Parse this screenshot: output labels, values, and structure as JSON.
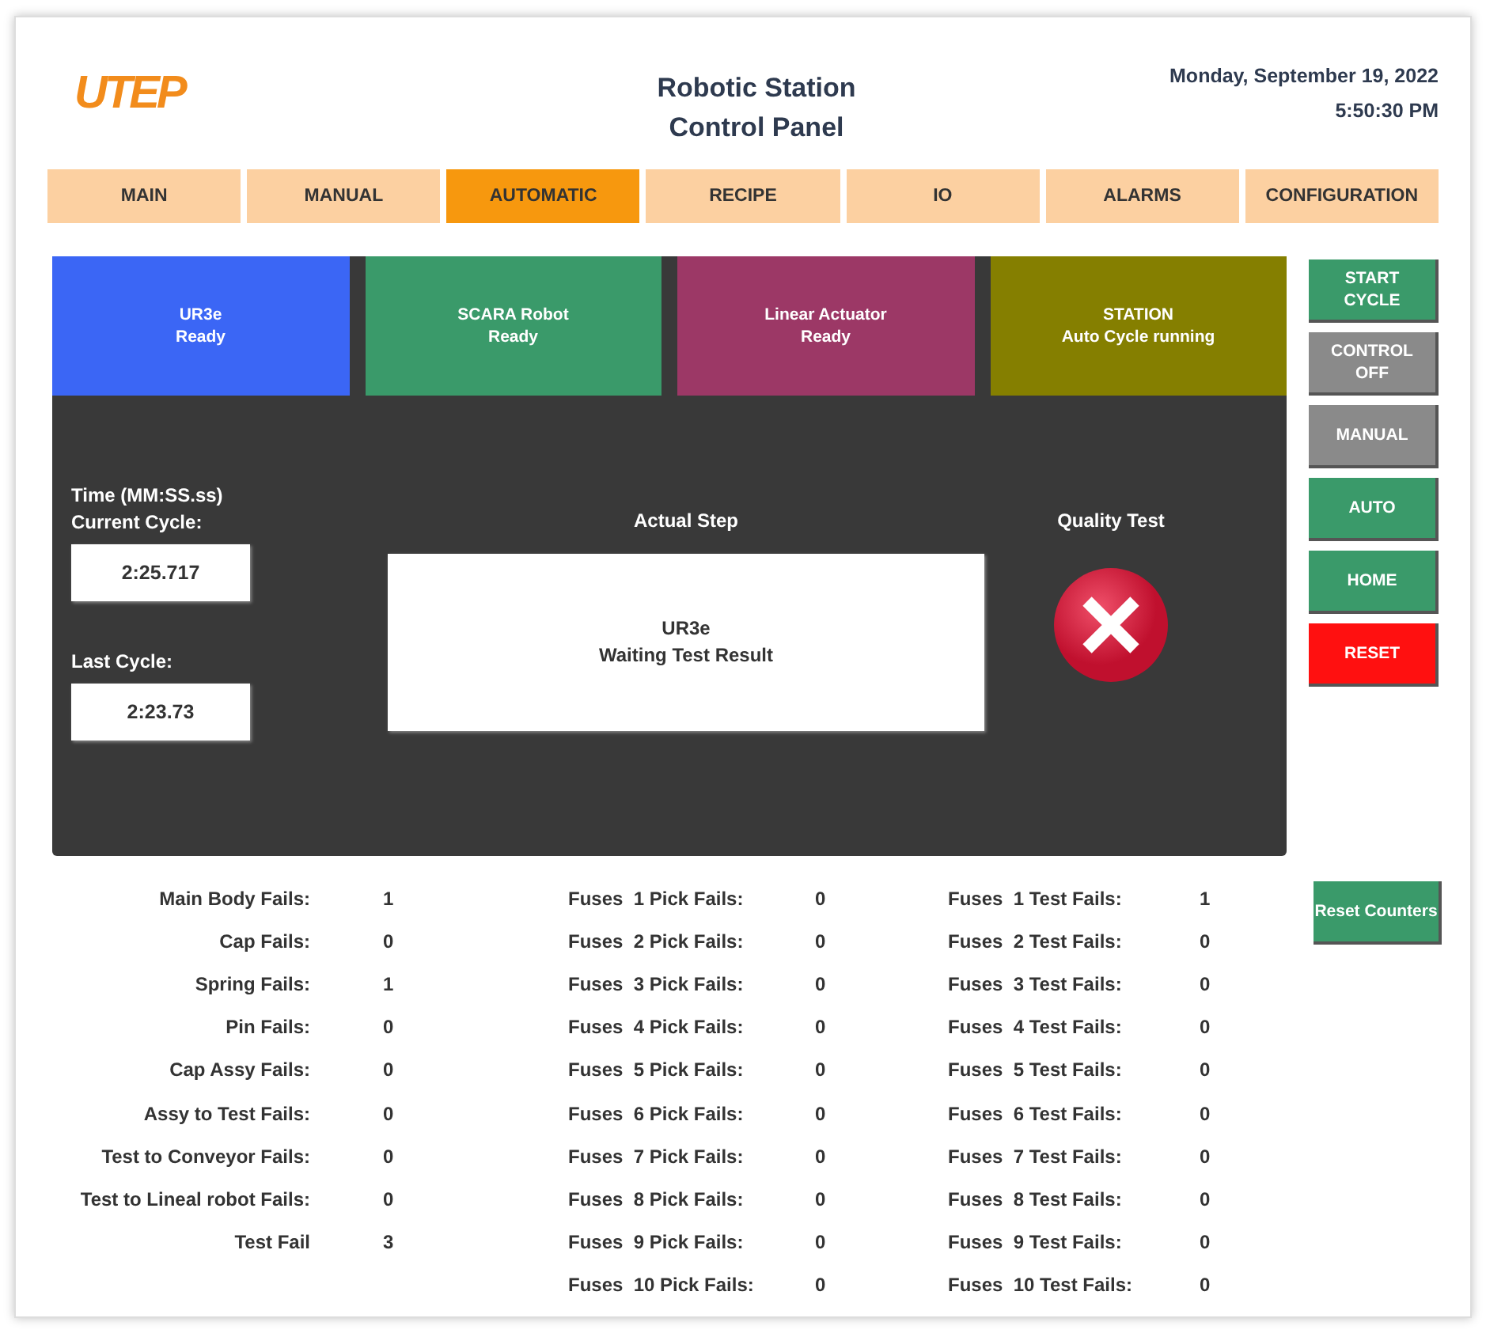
{
  "header": {
    "logo": "UTEP",
    "title_lines": [
      "Robotic Station",
      "Control Panel"
    ],
    "date": "Monday, September 19, 2022",
    "time": "5:50:30 PM"
  },
  "tabs": [
    {
      "label": "MAIN",
      "selected": false
    },
    {
      "label": "MANUAL",
      "selected": false
    },
    {
      "label": "AUTOMATIC",
      "selected": true
    },
    {
      "label": "RECIPE",
      "selected": false
    },
    {
      "label": "IO",
      "selected": false
    },
    {
      "label": "ALARMS",
      "selected": false
    },
    {
      "label": "CONFIGURATION",
      "selected": false
    }
  ],
  "status_tiles": [
    {
      "lines": [
        "UR3e",
        "Ready"
      ],
      "color": "#3b66f5"
    },
    {
      "lines": [
        "SCARA Robot",
        "Ready"
      ],
      "color": "#3a9a6a"
    },
    {
      "lines": [
        "Linear Actuator",
        "Ready"
      ],
      "color": "#9c3866"
    },
    {
      "lines": [
        "STATION",
        "Auto Cycle running"
      ],
      "color": "#857f00"
    }
  ],
  "times": {
    "heading": "Time (MM:SS.ss)",
    "current_label": "Current Cycle:",
    "current_value": "2:25.717",
    "last_label": "Last Cycle:",
    "last_value": "2:23.73"
  },
  "actual_step": {
    "label": "Actual Step",
    "lines": [
      "UR3e",
      "Waiting Test Result"
    ]
  },
  "quality_test": {
    "label": "Quality Test",
    "passed": false
  },
  "side_buttons": [
    {
      "lines": [
        "START",
        "CYCLE"
      ],
      "color": "#3a9a6a"
    },
    {
      "lines": [
        "CONTROL",
        "OFF"
      ],
      "color": "#8a8a8a"
    },
    {
      "lines": [
        "MANUAL"
      ],
      "color": "#8a8a8a"
    },
    {
      "lines": [
        "AUTO"
      ],
      "color": "#3a9a6a"
    },
    {
      "lines": [
        "HOME"
      ],
      "color": "#3a9a6a"
    },
    {
      "lines": [
        "RESET"
      ],
      "color": "#ff1010"
    }
  ],
  "counters": [
    [
      {
        "label": "Main Body Fails:",
        "value": "1"
      },
      {
        "label": "Cap Fails:",
        "value": "0"
      },
      {
        "label": "Spring Fails:",
        "value": "1"
      },
      {
        "label": "Pin Fails:",
        "value": "0"
      },
      {
        "label": "Cap Assy Fails:",
        "value": "0"
      },
      {
        "label": "Assy to Test Fails:",
        "value": "0"
      },
      {
        "label": "Test to Conveyor Fails:",
        "value": "0"
      },
      {
        "label": "Test to Lineal robot Fails:",
        "value": "0"
      },
      {
        "label": "Test Fail",
        "value": "3"
      }
    ],
    [
      {
        "label": "Fuses  1 Pick Fails:",
        "value": "0"
      },
      {
        "label": "Fuses  2 Pick Fails:",
        "value": "0"
      },
      {
        "label": "Fuses  3 Pick Fails:",
        "value": "0"
      },
      {
        "label": "Fuses  4 Pick Fails:",
        "value": "0"
      },
      {
        "label": "Fuses  5 Pick Fails:",
        "value": "0"
      },
      {
        "label": "Fuses  6 Pick Fails:",
        "value": "0"
      },
      {
        "label": "Fuses  7 Pick Fails:",
        "value": "0"
      },
      {
        "label": "Fuses  8 Pick Fails:",
        "value": "0"
      },
      {
        "label": "Fuses  9 Pick Fails:",
        "value": "0"
      },
      {
        "label": "Fuses  10 Pick Fails:",
        "value": "0"
      }
    ],
    [
      {
        "label": "Fuses  1 Test Fails:",
        "value": "1"
      },
      {
        "label": "Fuses  2 Test Fails:",
        "value": "0"
      },
      {
        "label": "Fuses  3 Test Fails:",
        "value": "0"
      },
      {
        "label": "Fuses  4 Test Fails:",
        "value": "0"
      },
      {
        "label": "Fuses  5 Test Fails:",
        "value": "0"
      },
      {
        "label": "Fuses  6 Test Fails:",
        "value": "0"
      },
      {
        "label": "Fuses  7 Test Fails:",
        "value": "0"
      },
      {
        "label": "Fuses  8 Test Fails:",
        "value": "0"
      },
      {
        "label": "Fuses  9 Test Fails:",
        "value": "0"
      },
      {
        "label": "Fuses  10 Test Fails:",
        "value": "0"
      }
    ]
  ],
  "reset_counters": "Reset Counters"
}
